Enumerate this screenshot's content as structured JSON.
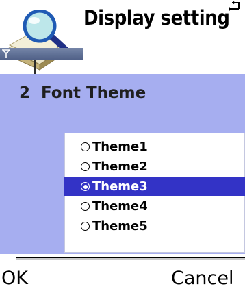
{
  "header": {
    "title": "Display setting",
    "app_icon": "search-settings-icon",
    "status_icon": "corner-return-icon",
    "signal_icon": "antenna-signal-icon"
  },
  "setting": {
    "number": "2",
    "label": "Font Theme"
  },
  "options": [
    {
      "label": "Theme1",
      "selected": false
    },
    {
      "label": "Theme2",
      "selected": false
    },
    {
      "label": "Theme3",
      "selected": true
    },
    {
      "label": "Theme4",
      "selected": false
    },
    {
      "label": "Theme5",
      "selected": false
    }
  ],
  "softkeys": {
    "left": "OK",
    "right": "Cancel"
  },
  "colors": {
    "background": "#a6aef0",
    "selection": "#3333c6",
    "header_bar": "#5a6a90"
  }
}
